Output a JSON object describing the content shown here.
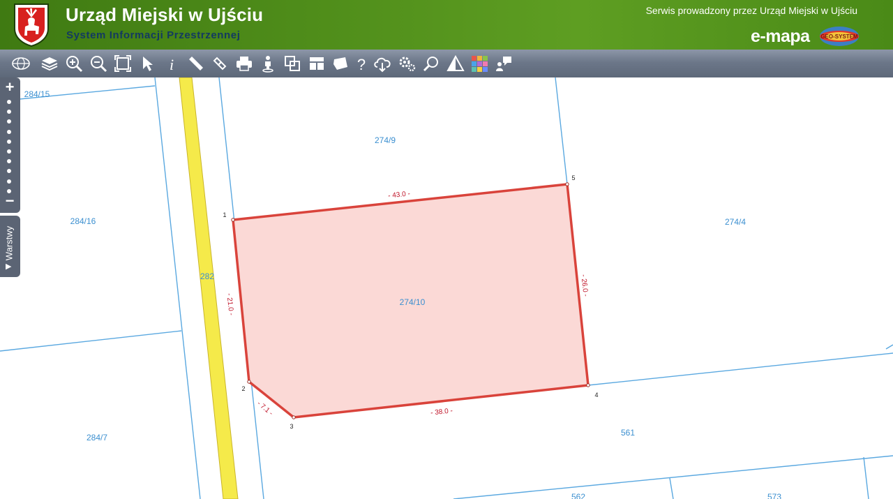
{
  "header": {
    "title": "Urząd Miejski w Ujściu",
    "subtitle": "System Informacji Przestrzennej",
    "service_text": "Serwis prowadzony przez Urząd Miejski w Ujściu",
    "brand": "e-mapa",
    "brand_badge": "GEO-SYSTEM"
  },
  "toolbar": {
    "items": [
      {
        "name": "geosystem-logo-icon"
      },
      {
        "name": "layers-icon"
      },
      {
        "name": "zoom-in-icon"
      },
      {
        "name": "zoom-out-icon"
      },
      {
        "name": "full-extent-icon"
      },
      {
        "name": "select-arrow-icon"
      },
      {
        "name": "info-icon"
      },
      {
        "name": "measure-ruler-icon"
      },
      {
        "name": "link-icon"
      },
      {
        "name": "print-icon"
      },
      {
        "name": "street-view-icon"
      },
      {
        "name": "copy-icon"
      },
      {
        "name": "layout-icon"
      },
      {
        "name": "shape-icon"
      },
      {
        "name": "help-icon"
      },
      {
        "name": "cloud-download-icon"
      },
      {
        "name": "settings-icon"
      },
      {
        "name": "search-icon"
      },
      {
        "name": "triangle-icon"
      },
      {
        "name": "color-grid-icon"
      },
      {
        "name": "user-comment-icon"
      }
    ]
  },
  "side": {
    "zoom_in": "+",
    "zoom_out": "−",
    "layers_label": "Warstwy",
    "layers_arrow": "▶"
  },
  "map": {
    "colors": {
      "parcel_line": "#5aa8e0",
      "parcel_label": "#3b8fd0",
      "highlight_fill": "#fbd9d6",
      "highlight_stroke": "#d9433b",
      "dimension": "#c0172b",
      "road": "#f5ea4a"
    },
    "parcel_labels": [
      "284/15",
      "274/9",
      "284/16",
      "274/4",
      "282",
      "274/10",
      "284/7",
      "561",
      "562",
      "573"
    ],
    "vertex_labels": [
      "1",
      "2",
      "3",
      "4",
      "5"
    ],
    "dimension_labels": [
      "- 43.0 -",
      "- 26.0 -",
      "- 21.0 -",
      "- 7.1 -",
      "- 38.0 -"
    ]
  }
}
